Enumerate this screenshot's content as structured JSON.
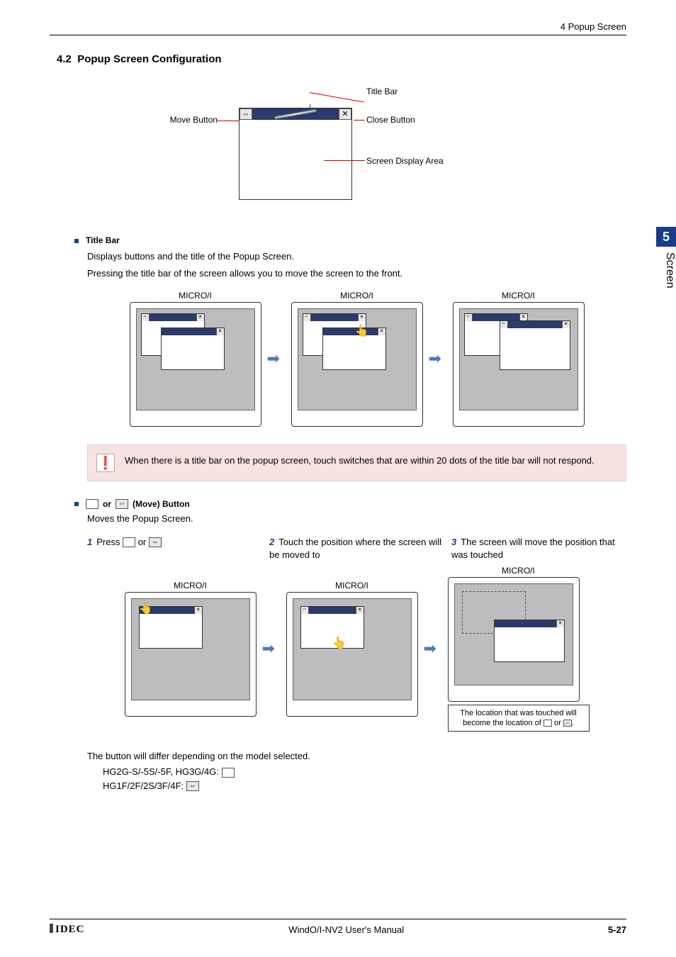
{
  "runhead": "4 Popup Screen",
  "section_number": "4.2",
  "section_title": "Popup Screen Configuration",
  "top_labels": {
    "move_btn": "Move Button",
    "title_bar": "Title Bar",
    "close_btn": "Close Button",
    "display_area": "Screen Display Area"
  },
  "titlebar": {
    "heading": "Title Bar",
    "line1": "Displays buttons and the title of the Popup Screen.",
    "line2": "Pressing the title bar of the screen allows you to move the screen to the front."
  },
  "panel_caption": "MICRO/I",
  "warning": "When there is a title bar on the popup screen, touch switches that are within 20 dots of the title bar will not respond.",
  "move_section": {
    "or_text": "or",
    "tail_text": "(Move) Button",
    "desc": "Moves the Popup Screen.",
    "step1_pre": "Press ",
    "step1_mid": " or ",
    "step2": "Touch the position where the screen will be moved to",
    "step3": "The screen will move the position that was touched",
    "note_a": "The location that was touched will become the location of ",
    "note_b": "or ",
    "note_c": "."
  },
  "model_intro": "The button will differ depending on the model selected.",
  "model_a": "HG2G-S/-5S/-5F, HG3G/4G:",
  "model_b": "HG1F/2F/2S/3F/4F:",
  "side_tab": {
    "chapter": "5",
    "label": "Screen"
  },
  "footer": {
    "brand": "IDEC",
    "center": "WindO/I-NV2 User's Manual",
    "page_prefix": "5-",
    "page": "27"
  },
  "icons": {
    "move": "⇔",
    "close": "✕"
  }
}
